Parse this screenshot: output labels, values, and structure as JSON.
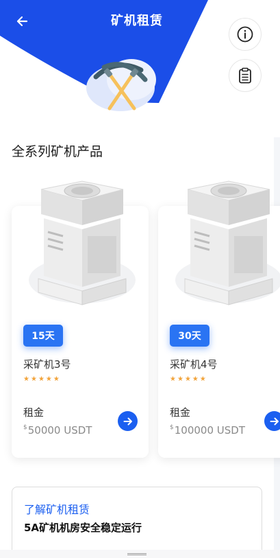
{
  "header": {
    "title": "矿机租赁",
    "accent_color": "#1b4ee8",
    "back_icon": "arrow-left-icon",
    "info_icon": "info-icon",
    "records_icon": "clipboard-icon"
  },
  "hero": {
    "icon": "crossed-pickaxes-icon"
  },
  "section": {
    "title": "全系列矿机产品"
  },
  "products": [
    {
      "days": "15天",
      "name": "采矿机3号",
      "rating": 5,
      "rent_label": "租金",
      "currency_symbol": "$",
      "price": "50000 USDT"
    },
    {
      "days": "30天",
      "name": "采矿机4号",
      "rating": 5,
      "rent_label": "租金",
      "currency_symbol": "$",
      "price": "100000 USDT"
    }
  ],
  "info": {
    "link": "了解矿机租赁",
    "description": "5A矿机机房安全稳定运行"
  }
}
